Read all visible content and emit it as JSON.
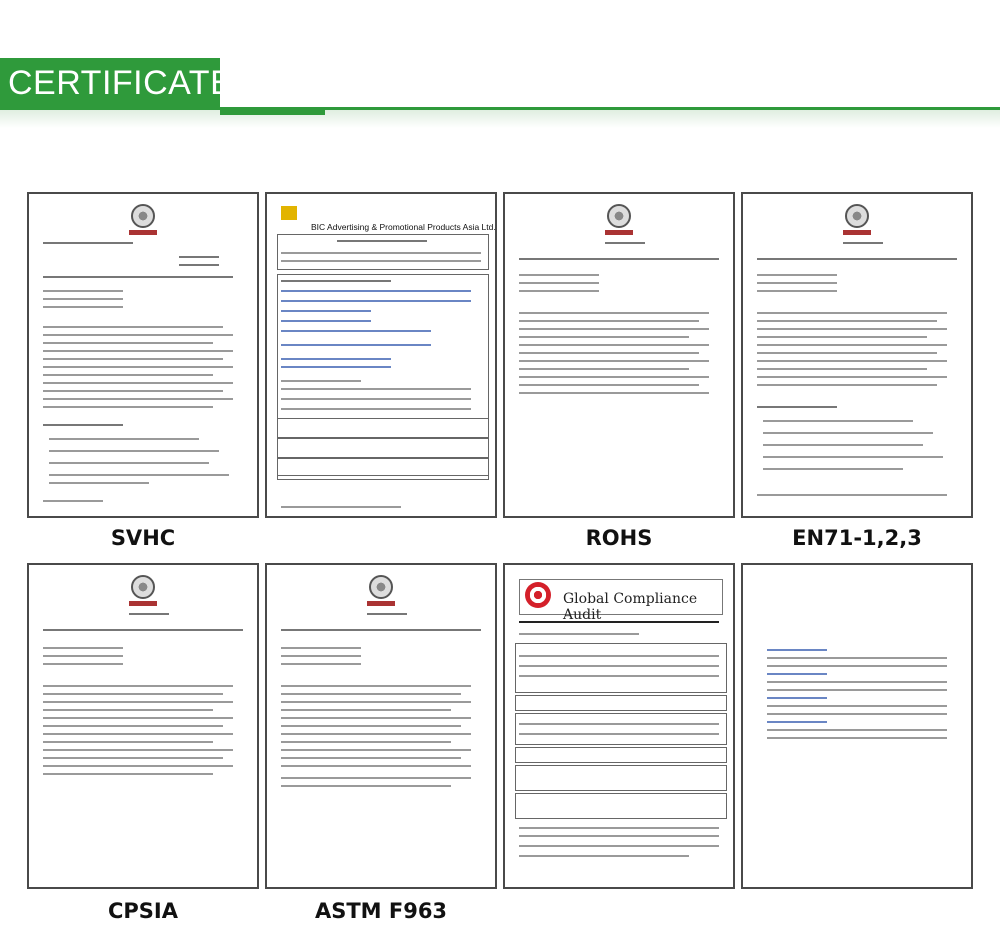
{
  "header": {
    "title": "CERTIFICATE"
  },
  "certificates": [
    {
      "label": "SVHC"
    },
    {
      "label": ""
    },
    {
      "label": "ROHS"
    },
    {
      "label": "EN71-1,2,3"
    },
    {
      "label": "CPSIA"
    },
    {
      "label": "ASTM F963"
    },
    {
      "label": ""
    },
    {
      "label": ""
    }
  ],
  "factory_audit": {
    "company": "BIC Advertising & Promotional Products Asia Ltd."
  },
  "compliance_audit": {
    "title": "Global Compliance Audit"
  },
  "colors": {
    "accent": "#2f9a3b",
    "frame": "#4a4a4a",
    "target_red": "#d4202a"
  }
}
